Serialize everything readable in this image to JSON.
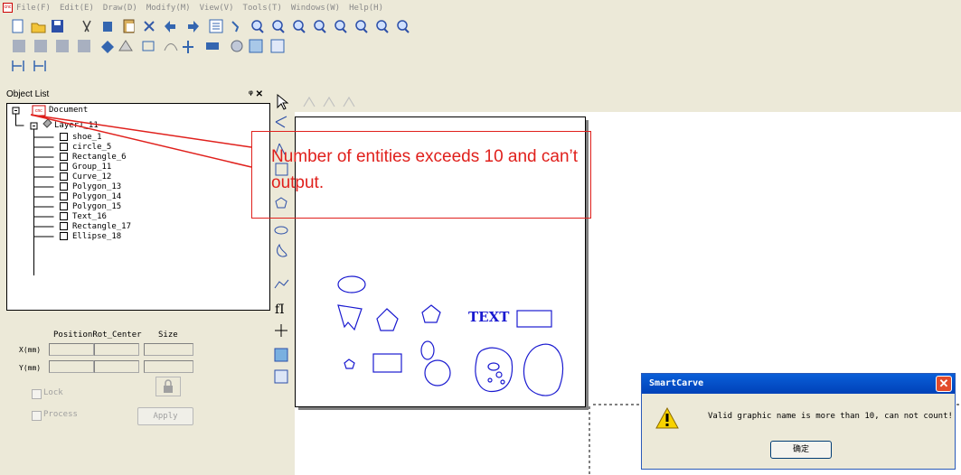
{
  "app": {
    "name": "SmartCarve"
  },
  "menu": [
    "File(F)",
    "Edit(E)",
    "Draw(D)",
    "Modify(M)",
    "View(V)",
    "Tools(T)",
    "Windows(W)",
    "Help(H)"
  ],
  "object_list": {
    "title": "Object List",
    "pin_label": "ᵠ ✕",
    "root": "Document",
    "layer": "Layer1_11",
    "items": [
      "shoe_1",
      "circle_5",
      "Rectangle_6",
      "Group_11",
      "Curve_12",
      "Polygon_13",
      "Polygon_14",
      "Polygon_15",
      "Text_16",
      "Rectangle_17",
      "Ellipse_18"
    ]
  },
  "position_panel": {
    "headers": [
      "Position",
      "Rot_Center",
      "Size"
    ],
    "x_label": "X(mm)",
    "y_label": "Y(mm)",
    "lock_label": "Lock",
    "process_label": "Process",
    "apply_label": "Apply"
  },
  "canvas": {
    "text_object": "TEXT"
  },
  "annotation": {
    "text": "Number of entities exceeds 10 and can’t output."
  },
  "dialog": {
    "title": "SmartCarve",
    "message": "Valid graphic name is more than 10, can not count!",
    "ok_label": "确定"
  },
  "colors": {
    "annotation": "#e0201c",
    "shapes": "#1a1ad0",
    "titlebar": "#0a5fd8"
  }
}
